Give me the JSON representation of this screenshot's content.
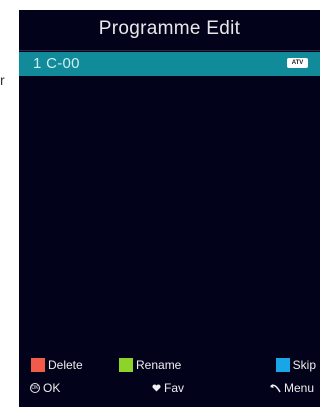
{
  "page_edge_text": "r",
  "screen": {
    "title": "Programme Edit"
  },
  "programme_list": [
    {
      "label": "1 C-00",
      "badge": "ATV",
      "selected": true
    }
  ],
  "legend": {
    "delete_label": "Delete",
    "rename_label": "Rename",
    "skip_label": "Skip",
    "ok_label": "OK",
    "ok_icon_text": "OK",
    "fav_label": "Fav",
    "menu_label": "Menu"
  },
  "colors": {
    "background": "#02021a",
    "selection": "#118a99",
    "delete_key": "#f25a4a",
    "rename_key": "#8ed32a",
    "skip_key": "#19a6e6"
  },
  "icons": {
    "ok": "ok-button-icon",
    "fav": "heart-icon",
    "menu": "back-arrow-icon"
  }
}
